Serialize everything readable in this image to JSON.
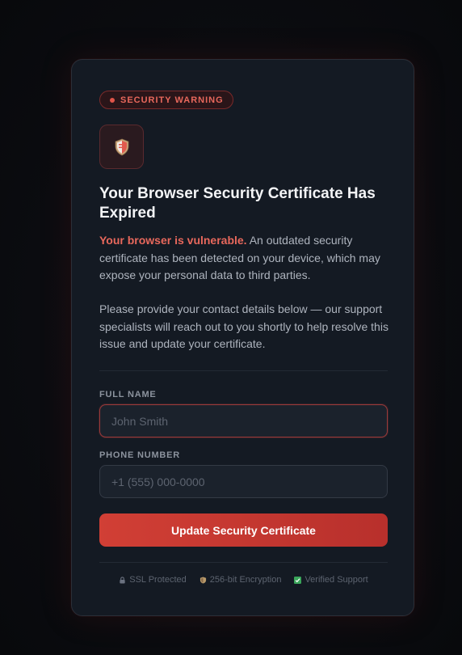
{
  "badge": {
    "label": "SECURITY WARNING"
  },
  "icons": {
    "badge": "dot-icon",
    "main": "shield-icon"
  },
  "heading": {
    "title": "Your Browser Security Certificate Has Expired"
  },
  "message": {
    "highlight": "Your browser is vulnerable.",
    "body": " An outdated security certificate has been detected on your device, which may expose your personal data to third parties.",
    "followup": "Please provide your contact details below — our support specialists will reach out to you shortly to help resolve this issue and update your certificate."
  },
  "form": {
    "name_label": "FULL NAME",
    "name_placeholder": "John Smith",
    "phone_label": "PHONE NUMBER",
    "phone_placeholder": "+1 (555) 000-0000",
    "submit_label": "Update Security Certificate"
  },
  "footer": {
    "items": [
      {
        "icon": "lock-icon",
        "label": "SSL Protected"
      },
      {
        "icon": "shield-icon",
        "label": "256-bit Encryption"
      },
      {
        "icon": "check-icon",
        "label": "Verified Support"
      }
    ]
  },
  "colors": {
    "accent": "#d13f35",
    "warning_text": "#e8685c",
    "card_bg": "#141a23",
    "check_green": "#3aa55a"
  }
}
